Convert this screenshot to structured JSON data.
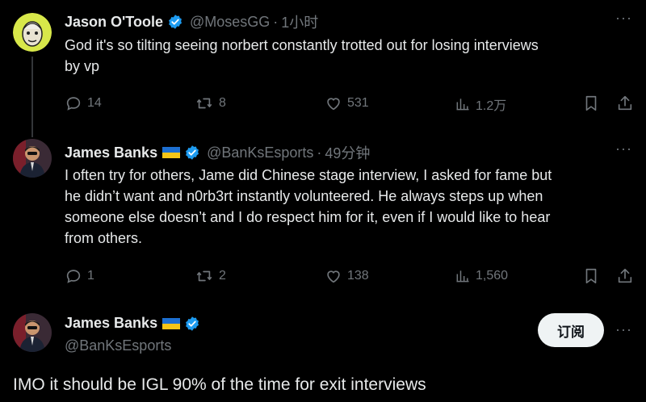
{
  "tweet1": {
    "name": "Jason O'Toole",
    "handle": "@MosesGG",
    "time": "1小时",
    "text_line1": "God it's so tilting seeing norbert constantly trotted out for losing interviews",
    "text_line2": "by vp",
    "replies": "14",
    "retweets": "8",
    "likes": "531",
    "views": "1.2万"
  },
  "tweet2": {
    "name": "James Banks",
    "handle": "@BanKsEsports",
    "time": "49分钟",
    "text_line1": "I often try for others, Jame did Chinese stage interview, I asked for fame but",
    "text_line2": "he didn’t want and n0rb3rt instantly volunteered. He always steps up when",
    "text_line3": "someone else doesn’t and I do respect him for it, even if I would like to hear",
    "text_line4": "from others.",
    "replies": "1",
    "retweets": "2",
    "likes": "138",
    "views": "1,560"
  },
  "tweet3": {
    "name": "James Banks",
    "handle": "@BanKsEsports",
    "follow_label": "订阅",
    "text": "IMO it should be IGL 90% of the time for exit interviews"
  },
  "colors": {
    "background": "#000000",
    "text": "#e7e9ea",
    "muted": "#71767b",
    "verified": "#1d9bf0",
    "thread_line": "#333639"
  },
  "icons": [
    "verified-badge-icon",
    "reply-icon",
    "retweet-icon",
    "like-icon",
    "views-icon",
    "bookmark-icon",
    "share-icon",
    "more-icon",
    "ukraine-flag-icon"
  ]
}
